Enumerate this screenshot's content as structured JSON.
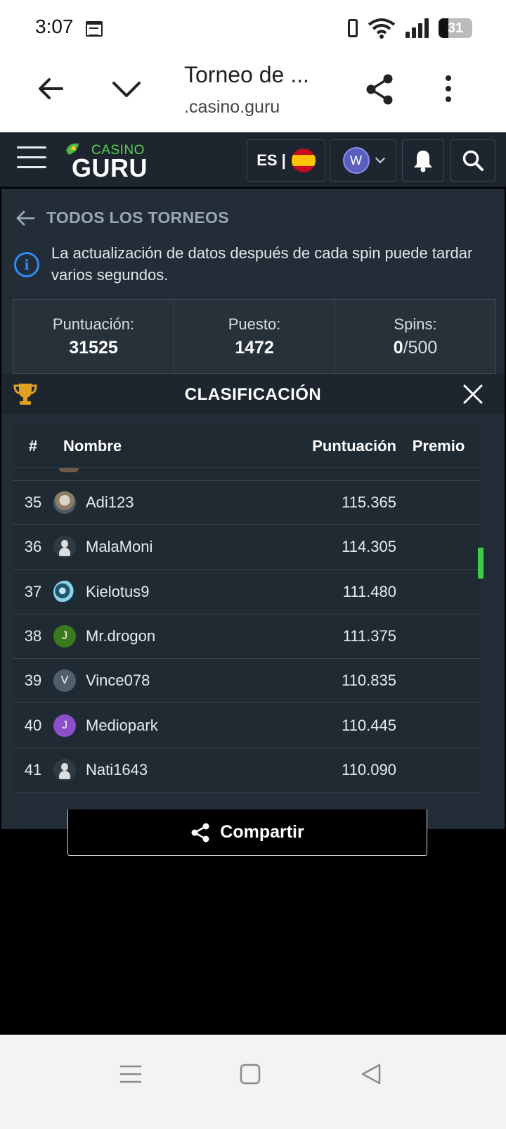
{
  "status_bar": {
    "time": "3:07",
    "battery": "31"
  },
  "browser": {
    "title": "Torneo de ...",
    "url": ".casino.guru"
  },
  "site_header": {
    "logo_top": "CASINO",
    "logo_bottom": "GURU",
    "language": "ES |",
    "user_initial": "W"
  },
  "panel": {
    "back_label": "TODOS LOS TORNEOS",
    "info_text": "La actualización de datos después de cada spin puede tardar varios segundos.",
    "stats": {
      "score_label": "Puntuación:",
      "score_value": "31525",
      "rank_label": "Puesto:",
      "rank_value": "1472",
      "spins_label": "Spins:",
      "spins_used": "0",
      "spins_total": "/500"
    },
    "leaderboard_title": "CLASIFICACIÓN"
  },
  "table": {
    "headers": {
      "rank": "#",
      "name": "Nombre",
      "score": "Puntuación",
      "prize": "Premio"
    },
    "rows": [
      {
        "rank": "35",
        "name": "Adi123",
        "score": "115.365",
        "avatar": "photo",
        "initial": ""
      },
      {
        "rank": "36",
        "name": "MalaMoni",
        "score": "114.305",
        "avatar": "default",
        "initial": ""
      },
      {
        "rank": "37",
        "name": "Kielotus9",
        "score": "111.480",
        "avatar": "photo",
        "initial": ""
      },
      {
        "rank": "38",
        "name": "Mr.drogon",
        "score": "111.375",
        "avatar": "initial",
        "initial": "J",
        "color": "#3a7a1e"
      },
      {
        "rank": "39",
        "name": "Vince078",
        "score": "110.835",
        "avatar": "initial",
        "initial": "V",
        "color": "#4f5f6c"
      },
      {
        "rank": "40",
        "name": "Mediopark",
        "score": "110.445",
        "avatar": "initial",
        "initial": "J",
        "color": "#8a4fc9"
      },
      {
        "rank": "41",
        "name": "Nati1643",
        "score": "110.090",
        "avatar": "default",
        "initial": ""
      }
    ]
  },
  "share": {
    "label": "Compartir",
    "progress_fraction": 0.62
  },
  "colors": {
    "accent_green": "#3ecb4a",
    "info_blue": "#2f8cf5",
    "panel_bg": "#222d37"
  }
}
